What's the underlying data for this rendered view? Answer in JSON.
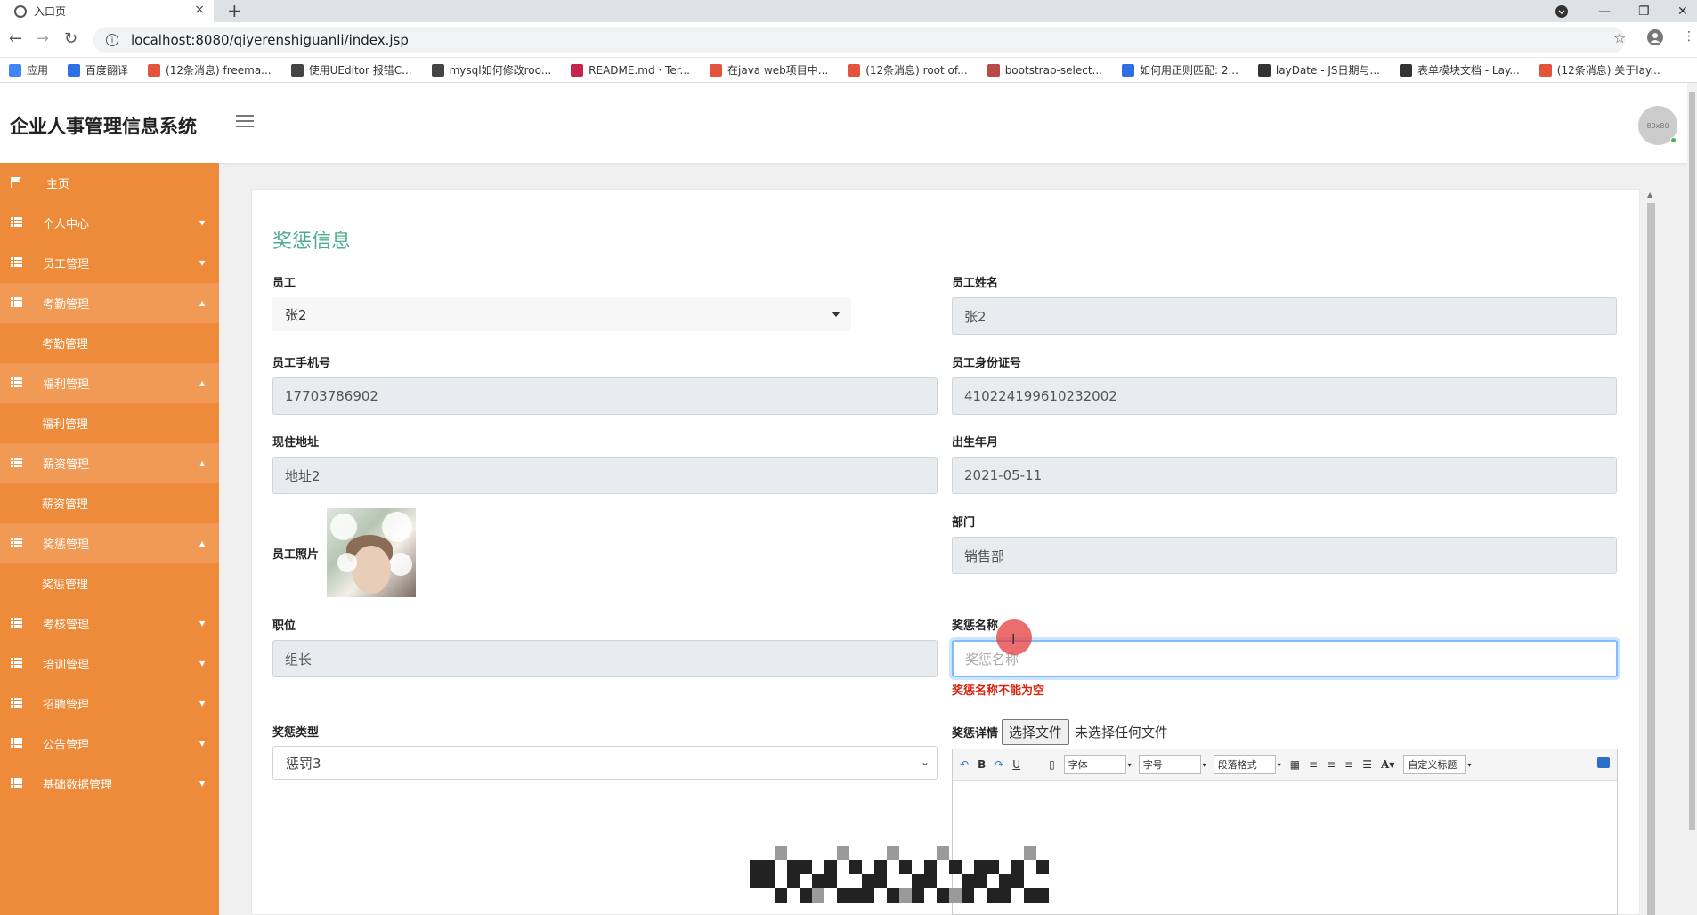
{
  "browser": {
    "tab_title": "入口页",
    "tab_close": "×",
    "new_tab": "+",
    "url": "localhost:8080/qiyerenshiguanli/index.jsp",
    "win_min": "—",
    "win_restore": "❐",
    "win_close": "✕",
    "bookmarks": [
      {
        "label": "应用",
        "color": "#4285f4"
      },
      {
        "label": "百度翻译",
        "color": "#2f6fe4"
      },
      {
        "label": "(12条消息) freema...",
        "color": "#e2543c"
      },
      {
        "label": "使用UEditor 报错C...",
        "color": "#444444"
      },
      {
        "label": "mysql如何修改roo...",
        "color": "#444444"
      },
      {
        "label": "README.md · Ter...",
        "color": "#c7254e"
      },
      {
        "label": "在java web项目中...",
        "color": "#e2543c"
      },
      {
        "label": "(12条消息) root of...",
        "color": "#e2543c"
      },
      {
        "label": "bootstrap-select...",
        "color": "#b94a48"
      },
      {
        "label": "如何用正则匹配: 2...",
        "color": "#2f6fe4"
      },
      {
        "label": "layDate - JS日期与...",
        "color": "#333333"
      },
      {
        "label": "表单模块文档 - Lay...",
        "color": "#333333"
      },
      {
        "label": "(12条消息) 关于lay...",
        "color": "#e2543c"
      }
    ]
  },
  "header": {
    "title": "企业人事管理信息系统",
    "avatar_text": "80x80"
  },
  "sidebar": {
    "items": [
      {
        "label": "主页",
        "type": "item",
        "chev": ""
      },
      {
        "label": "个人中心",
        "type": "item",
        "chev": "▼"
      },
      {
        "label": "员工管理",
        "type": "item",
        "chev": "▼"
      },
      {
        "label": "考勤管理",
        "type": "open",
        "chev": "▲"
      },
      {
        "label": "考勤管理",
        "type": "sub",
        "chev": ""
      },
      {
        "label": "福利管理",
        "type": "open",
        "chev": "▲"
      },
      {
        "label": "福利管理",
        "type": "sub",
        "chev": ""
      },
      {
        "label": "薪资管理",
        "type": "open",
        "chev": "▲"
      },
      {
        "label": "薪资管理",
        "type": "sub",
        "chev": ""
      },
      {
        "label": "奖惩管理",
        "type": "open",
        "chev": "▲"
      },
      {
        "label": "奖惩管理",
        "type": "sub",
        "chev": ""
      },
      {
        "label": "考核管理",
        "type": "item",
        "chev": "▼"
      },
      {
        "label": "培训管理",
        "type": "item",
        "chev": "▼"
      },
      {
        "label": "招聘管理",
        "type": "item",
        "chev": "▼"
      },
      {
        "label": "公告管理",
        "type": "item",
        "chev": "▼"
      },
      {
        "label": "基础数据管理",
        "type": "item",
        "chev": "▼"
      }
    ]
  },
  "form": {
    "section_title": "奖惩信息",
    "employee_label": "员工",
    "employee_value": "张2",
    "name_label": "员工姓名",
    "name_value": "张2",
    "phone_label": "员工手机号",
    "phone_value": "17703786902",
    "idcard_label": "员工身份证号",
    "idcard_value": "410224199610232002",
    "address_label": "现住地址",
    "address_value": "地址2",
    "birth_label": "出生年月",
    "birth_value": "2021-05-11",
    "photo_label": "员工照片",
    "dept_label": "部门",
    "dept_value": "销售部",
    "position_label": "职位",
    "position_value": "组长",
    "reward_name_label": "奖惩名称",
    "reward_name_placeholder": "奖惩名称",
    "reward_name_error": "奖惩名称不能为空",
    "reward_type_label": "奖惩类型",
    "reward_type_value": "惩罚3",
    "reward_type_chev": "⌄",
    "detail_label": "奖惩详情",
    "file_button": "选择文件",
    "file_status": "未选择任何文件"
  },
  "editor": {
    "undo": "↶",
    "bold": "B",
    "redo": "↷",
    "underline": "U",
    "hr": "—",
    "font_family": "字体",
    "font_size": "字号",
    "paragraph": "段落格式",
    "font_color": "A",
    "custom_title": "自定义标题"
  }
}
